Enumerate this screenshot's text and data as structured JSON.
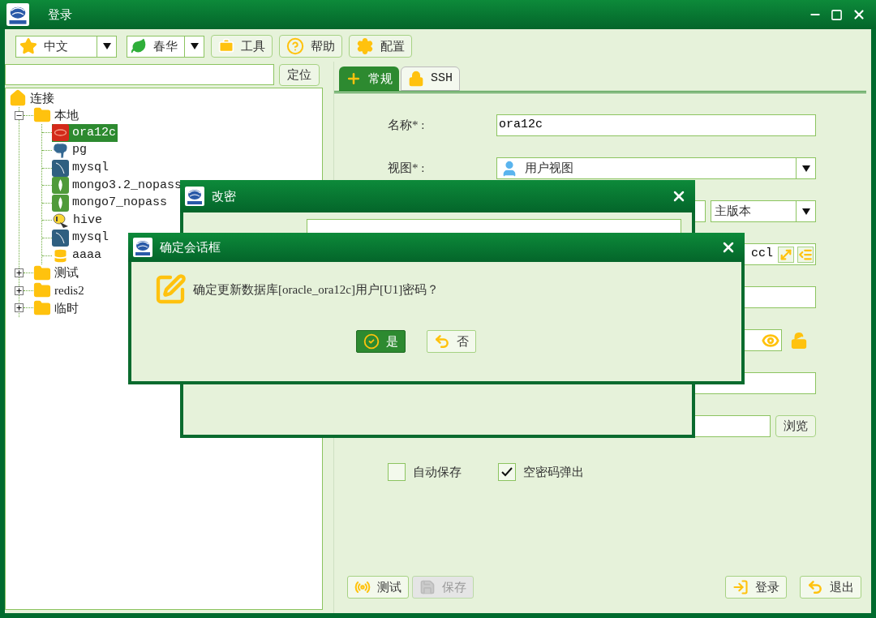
{
  "window": {
    "title": "登录"
  },
  "toolbar": {
    "language": "中文",
    "theme": "春华",
    "buttons": [
      {
        "kind": "tools",
        "label": "工具"
      },
      {
        "kind": "help",
        "label": "帮助"
      },
      {
        "kind": "settings",
        "label": "配置"
      }
    ]
  },
  "search": {
    "button": "定位"
  },
  "tree": {
    "label": "连接",
    "kind": "home",
    "children": [
      {
        "label": "本地",
        "kind": "folder",
        "expanded": true,
        "selected": false,
        "children": [
          {
            "label": "ora12c",
            "kind": "oracle",
            "selected": true
          },
          {
            "label": "pg",
            "kind": "pg",
            "selected": false
          },
          {
            "label": "mysql",
            "kind": "mysql",
            "selected": false
          },
          {
            "label": "mongo3.2_nopass",
            "kind": "mongo",
            "selected": false
          },
          {
            "label": "mongo7_nopass",
            "kind": "mongo",
            "selected": false
          },
          {
            "label": "hive",
            "kind": "hive",
            "selected": false
          },
          {
            "label": "mysql",
            "kind": "mysql",
            "selected": false
          },
          {
            "label": "aaaa",
            "kind": "db",
            "selected": false
          }
        ]
      },
      {
        "label": "测试",
        "kind": "folder",
        "expanded": false,
        "selected": false
      },
      {
        "label": "redis2",
        "kind": "folder",
        "expanded": false,
        "selected": false
      },
      {
        "label": "临时",
        "kind": "folder",
        "expanded": false,
        "selected": false
      }
    ]
  },
  "tabs": [
    {
      "label": "常规",
      "kind": "general",
      "selected": true
    },
    {
      "label": "SSH",
      "kind": "lock",
      "selected": false
    }
  ],
  "form": {
    "name": {
      "label": "名称* :",
      "value": "ora12c"
    },
    "view": {
      "label": "视图* :",
      "value": "用户视图"
    },
    "version": {
      "value": "主版本"
    },
    "connection": {
      "value": "ccl"
    },
    "browse_button": "浏览"
  },
  "options": [
    {
      "label": "自动保存",
      "checked": false
    },
    {
      "label": "空密码弹出",
      "checked": true
    }
  ],
  "footer_buttons": [
    {
      "kind": "test",
      "label": "测试",
      "disabled": false
    },
    {
      "kind": "save",
      "label": "保存",
      "disabled": true
    },
    {
      "kind": "login",
      "label": "登录",
      "disabled": false
    },
    {
      "kind": "exit",
      "label": "退出",
      "disabled": false
    }
  ],
  "password_dialog": {
    "title": "改密"
  },
  "confirm_dialog": {
    "title": "确定会话框",
    "message": "确定更新数据库[oracle_ora12c]用户[U1]密码？",
    "buttons": [
      {
        "kind": "yes",
        "label": "是",
        "selected": true
      },
      {
        "kind": "no",
        "label": "否",
        "selected": false
      }
    ]
  }
}
